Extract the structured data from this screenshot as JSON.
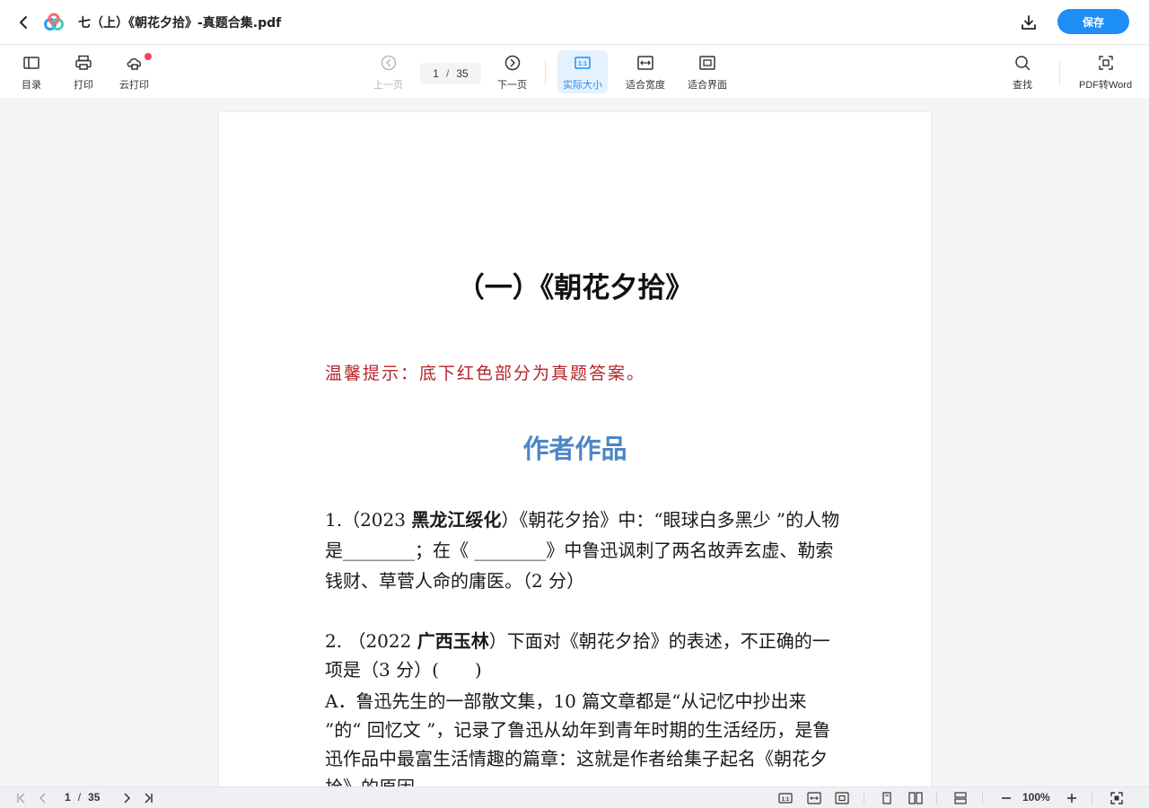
{
  "titlebar": {
    "title": "七（上）《朝花夕拾》-真题合集.pdf",
    "save_label": "保存"
  },
  "toolbar": {
    "toc": "目录",
    "print": "打印",
    "cloud_print": "云打印",
    "prev_page": "上一页",
    "current_page": "1",
    "separator": "/",
    "total_pages": "35",
    "next_page": "下一页",
    "actual_size": "实际大小",
    "fit_width": "适合宽度",
    "fit_screen": "适合界面",
    "find": "查找",
    "pdf_to_word": "PDF转Word",
    "accent_color": "#1e8ef7"
  },
  "document": {
    "heading": "（一）《朝花夕拾》",
    "tip": "温馨提示：底下红色部分为真题答案。",
    "section_title": "作者作品",
    "q1": {
      "prefix": " 1.（2023 ",
      "region": "黑龙江绥化",
      "body": "）《朝花夕拾》中：“眼球白多黑少 ”的人物是________；在《 ________》中鲁迅讽刺了两名故弄玄虚、勒索钱财、草菅人命的庸医。（2 分）"
    },
    "q2": {
      "prefix": "2. （2022 ",
      "region": "广西玉林",
      "body": "）下面对《朝花夕拾》的表述，不正确的一项是（3 分）(　　)"
    },
    "option_a": "A．鲁迅先生的一部散文集，10 篇文章都是“从记忆中抄出来 ”的“ 回忆文 ”，记录了鲁迅从幼年到青年时期的生活经历，是鲁迅作品中最富生活情趣的篇章：这就是作者给集子起名《朝花夕拾》的原因。"
  },
  "statusbar": {
    "current_page": "1",
    "separator": "/",
    "total_pages": "35",
    "zoom": "100%"
  }
}
